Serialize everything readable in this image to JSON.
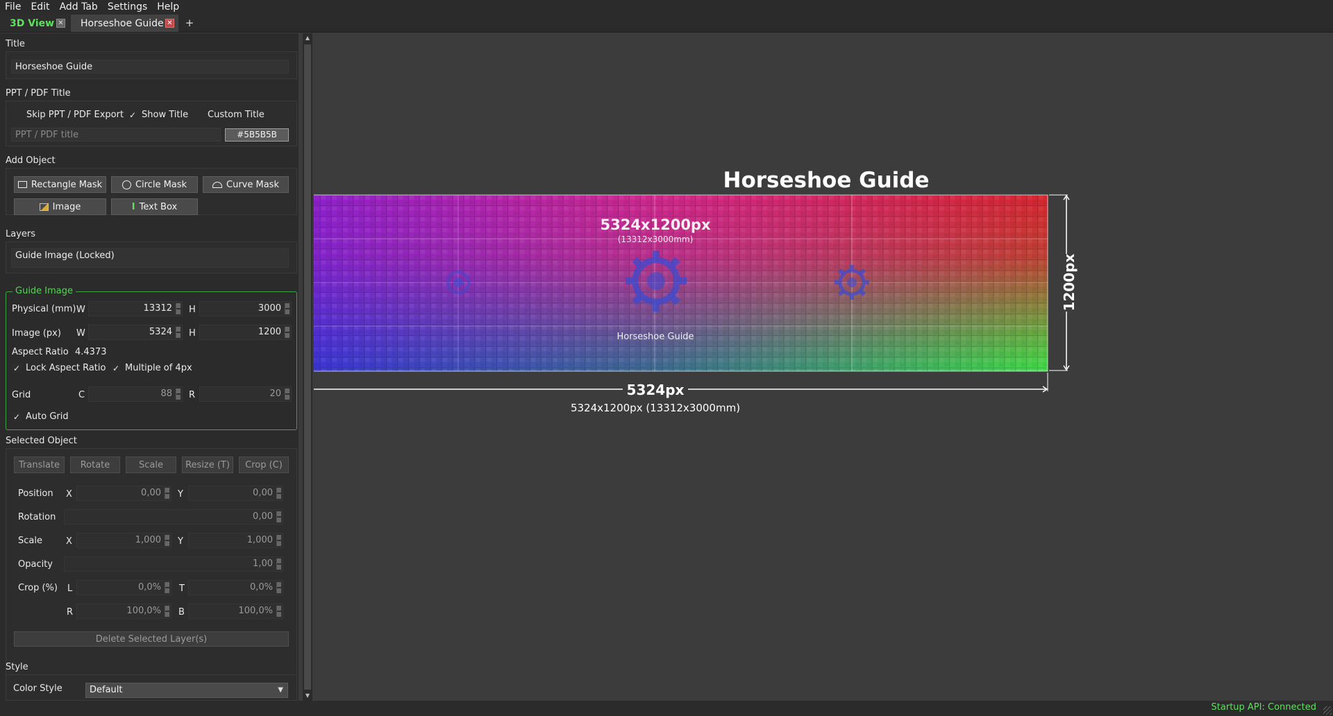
{
  "menu": [
    "File",
    "Edit",
    "Add Tab",
    "Settings",
    "Help"
  ],
  "tabs": [
    {
      "label": "3D View",
      "close": "✕"
    },
    {
      "label": "Horseshoe Guide",
      "close": "✕"
    }
  ],
  "add_tab_glyph": "+",
  "panel": {
    "title_section": {
      "heading": "Title",
      "value": "Horseshoe Guide"
    },
    "ppt_section": {
      "heading": "PPT / PDF Title",
      "skip_export": "Skip PPT / PDF Export",
      "show_title": "Show Title",
      "custom_title": "Custom Title",
      "title_placeholder": "PPT / PDF title",
      "color_value": "#5B5B5B"
    },
    "add_object": {
      "heading": "Add Object",
      "rect_mask": "Rectangle Mask",
      "circle_mask": "Circle Mask",
      "curve_mask": "Curve Mask",
      "image": "Image",
      "text_box": "Text Box"
    },
    "layers": {
      "heading": "Layers",
      "item": "Guide Image (Locked)"
    },
    "guide_image": {
      "legend": "Guide Image",
      "physical_label": "Physical (mm)",
      "w_label": "W",
      "h_label": "H",
      "physical_w": "13312",
      "physical_h": "3000",
      "image_label": "Image (px)",
      "image_w": "5324",
      "image_h": "1200",
      "aspect_label": "Aspect Ratio",
      "aspect_value": "4.4373",
      "lock_aspect": "Lock Aspect Ratio",
      "multiple4": "Multiple of 4px",
      "grid_label": "Grid",
      "c_label": "C",
      "r_label": "R",
      "grid_c": "88",
      "grid_r": "20",
      "auto_grid": "Auto Grid"
    },
    "selected_object": {
      "heading": "Selected Object",
      "translate": "Translate",
      "rotate": "Rotate",
      "scale": "Scale",
      "resize": "Resize (T)",
      "crop": "Crop (C)",
      "position_label": "Position",
      "x_label": "X",
      "y_label": "Y",
      "pos_x": "0,00",
      "pos_y": "0,00",
      "rotation_label": "Rotation",
      "rotation": "0,00",
      "scale_label": "Scale",
      "scale_x": "1,000",
      "scale_y": "1,000",
      "opacity_label": "Opacity",
      "opacity": "1,00",
      "crop_label": "Crop (%)",
      "l_label": "L",
      "t_label": "T",
      "r_label": "R",
      "b_label": "B",
      "crop_l": "0,0%",
      "crop_t": "0,0%",
      "crop_r": "100,0%",
      "crop_b": "100,0%",
      "delete": "Delete Selected Layer(s)"
    },
    "style": {
      "heading": "Style",
      "color_style_label": "Color Style",
      "color_style_value": "Default"
    }
  },
  "canvas": {
    "title": "Horseshoe Guide",
    "center_size": "5324x1200px",
    "center_mm": "(13312x3000mm)",
    "bottom_label": "Horseshoe Guide",
    "width_dim": "5324px",
    "height_dim": "1200px",
    "summary": "5324x1200px (13312x3000mm)"
  },
  "status": "Startup API: Connected",
  "colors": {
    "accent_green": "#5ee05e",
    "guide_border": "#3da64a",
    "panel_bg": "#2b2b2b",
    "canvas_bg": "#3c3c3c"
  }
}
